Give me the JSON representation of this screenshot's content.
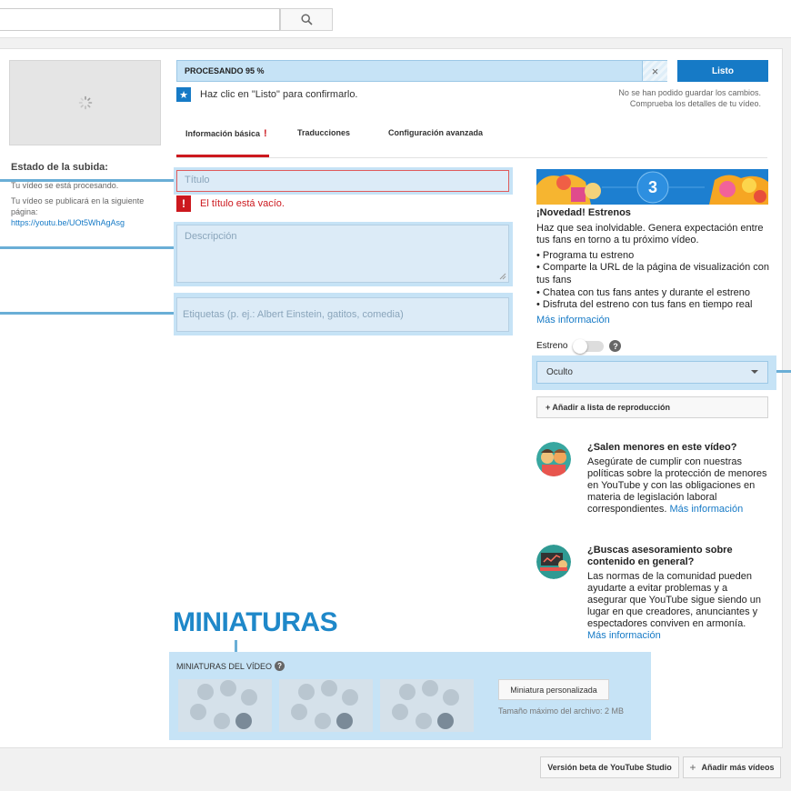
{
  "search": {
    "placeholder": ""
  },
  "preview": {
    "status_heading": "Estado de la subida:",
    "processing_text": "Tu vídeo se está procesando.",
    "publish_text": "Tu vídeo se publicará en la siguiente página:",
    "link": "https://youtu.be/UOt5WhAgAsg"
  },
  "progress": {
    "label": "PROCESANDO 95 %",
    "value": 0.95,
    "done_label": "Listo"
  },
  "confirm": {
    "text": "Haz clic en \"Listo\" para confirmarlo."
  },
  "save_message": {
    "line1": "No se han podido guardar los cambios.",
    "line2": "Comprueba los detalles de tu vídeo."
  },
  "tabs": [
    {
      "label": "Información básica",
      "badge": "!"
    },
    {
      "label": "Traducciones"
    },
    {
      "label": "Configuración avanzada"
    }
  ],
  "form": {
    "title_placeholder": "Título",
    "title_error": "El título está vacío.",
    "description_placeholder": "Descripción",
    "tags_placeholder": "Etiquetas (p. ej.: Albert Einstein, gatitos, comedia)"
  },
  "promo": {
    "banner_number": "3",
    "heading": "¡Novedad! Estrenos",
    "body": "Haz que sea inolvidable. Genera expectación entre tus fans en torno a tu próximo vídeo.",
    "bullets": [
      "• Programa tu estreno",
      "• Comparte la URL de la página de visualización con tus fans",
      "• Chatea con tus fans antes y durante el estreno",
      "• Disfruta del estreno con tus fans en tiempo real"
    ],
    "more": "Más información"
  },
  "premiere": {
    "label": "Estreno",
    "help": "?",
    "enabled": false
  },
  "privacy": {
    "selected": "Oculto"
  },
  "playlist": {
    "label": "+ Añadir a lista de reproducción"
  },
  "info_minors": {
    "heading": "¿Salen menores en este vídeo?",
    "body": "Asegúrate de cumplir con nuestras políticas sobre la protección de menores en YouTube y con las obligaciones en materia de legislación laboral correspondientes.",
    "link": "Más información"
  },
  "info_advice": {
    "heading": "¿Buscas asesoramiento sobre contenido en general?",
    "body": "Las normas de la comunidad pueden ayudarte a evitar problemas y a asegurar que YouTube sigue siendo un lugar en que creadores, anunciantes y espectadores conviven en armonía.",
    "link": "Más información"
  },
  "thumbnails": {
    "section_title": "MINIATURAS",
    "label": "MINIATURAS DEL VÍDEO",
    "help": "?",
    "custom_button": "Miniatura personalizada",
    "max_size": "Tamaño máximo del archivo: 2 MB"
  },
  "footer": {
    "beta_button": "Versión beta de YouTube Studio",
    "add_more_button": "Añadir más vídeos",
    "add_icon": "+"
  },
  "colors": {
    "accent": "#167ac6",
    "error": "#cc181e",
    "highlight": "#c6e3f6",
    "annotation": "#1f88c9"
  }
}
